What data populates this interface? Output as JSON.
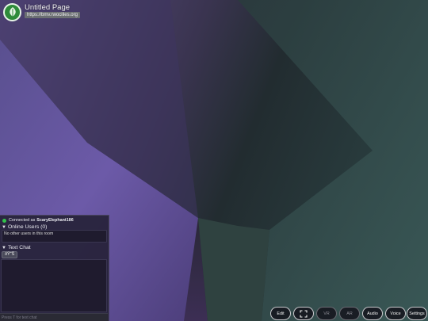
{
  "header": {
    "title": "Untitled Page",
    "url": "https://bmv.rwocilies.org"
  },
  "panel": {
    "connected_prefix": "Connected as",
    "username": "ScaryElephant186",
    "online_users_label": "Online Users (0)",
    "no_users_text": "No other users in this room",
    "text_chat_label": "Text Chat",
    "emoji_button": "ðŸ˜Š",
    "chat_placeholder": "Press T for text chat"
  },
  "controls": {
    "edit": "Edit",
    "vr": "VR",
    "ar": "AR",
    "audio": "Audio",
    "voice": "Voice",
    "settings": "Settings"
  },
  "colors": {
    "status_green": "#32c24a",
    "logo_green": "#2e8b3a",
    "scene_purple": "#6a5a9e",
    "scene_teal": "#36504f"
  }
}
